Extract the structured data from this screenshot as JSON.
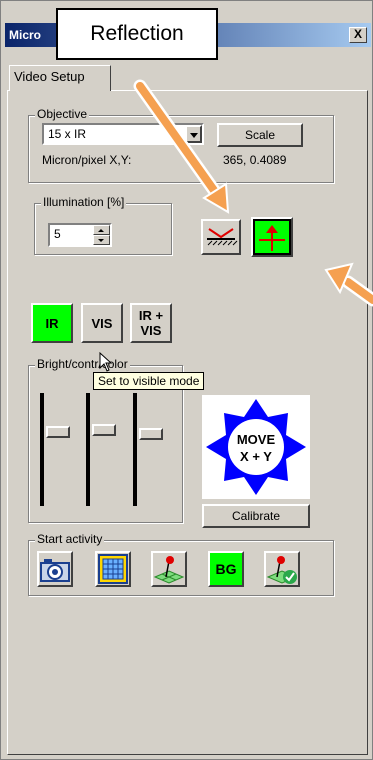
{
  "window": {
    "title": "Micro",
    "close_label": "X"
  },
  "tab": {
    "label": "Video Setup"
  },
  "objective": {
    "legend": "Objective",
    "selected": "15 x IR",
    "scale_label": "Scale",
    "micron_label": "Micron/pixel X,Y:",
    "micron_value": "365, 0.4089"
  },
  "illumination": {
    "legend": "Illumination [%]",
    "value": "5"
  },
  "modes": {
    "ir": "IR",
    "vis": "VIS",
    "ir_vis_line1": "IR +",
    "ir_vis_line2": "VIS"
  },
  "brightness": {
    "legend": "Bright/contr/color"
  },
  "tooltip": {
    "text": "Set to visible mode"
  },
  "move": {
    "line1": "MOVE",
    "line2": "X + Y",
    "calibrate_label": "Calibrate"
  },
  "activity": {
    "legend": "Start activity",
    "bg_label": "BG"
  },
  "annotation": {
    "callout": "Reflection"
  },
  "colors": {
    "active_green": "#00ff00",
    "move_blue": "#0000ff",
    "arrow_orange": "#f5a050"
  },
  "icons": [
    "reflection-icon",
    "transmission-icon",
    "camera-icon",
    "grid-icon",
    "pin-map-icon",
    "pin-map-check-icon"
  ]
}
